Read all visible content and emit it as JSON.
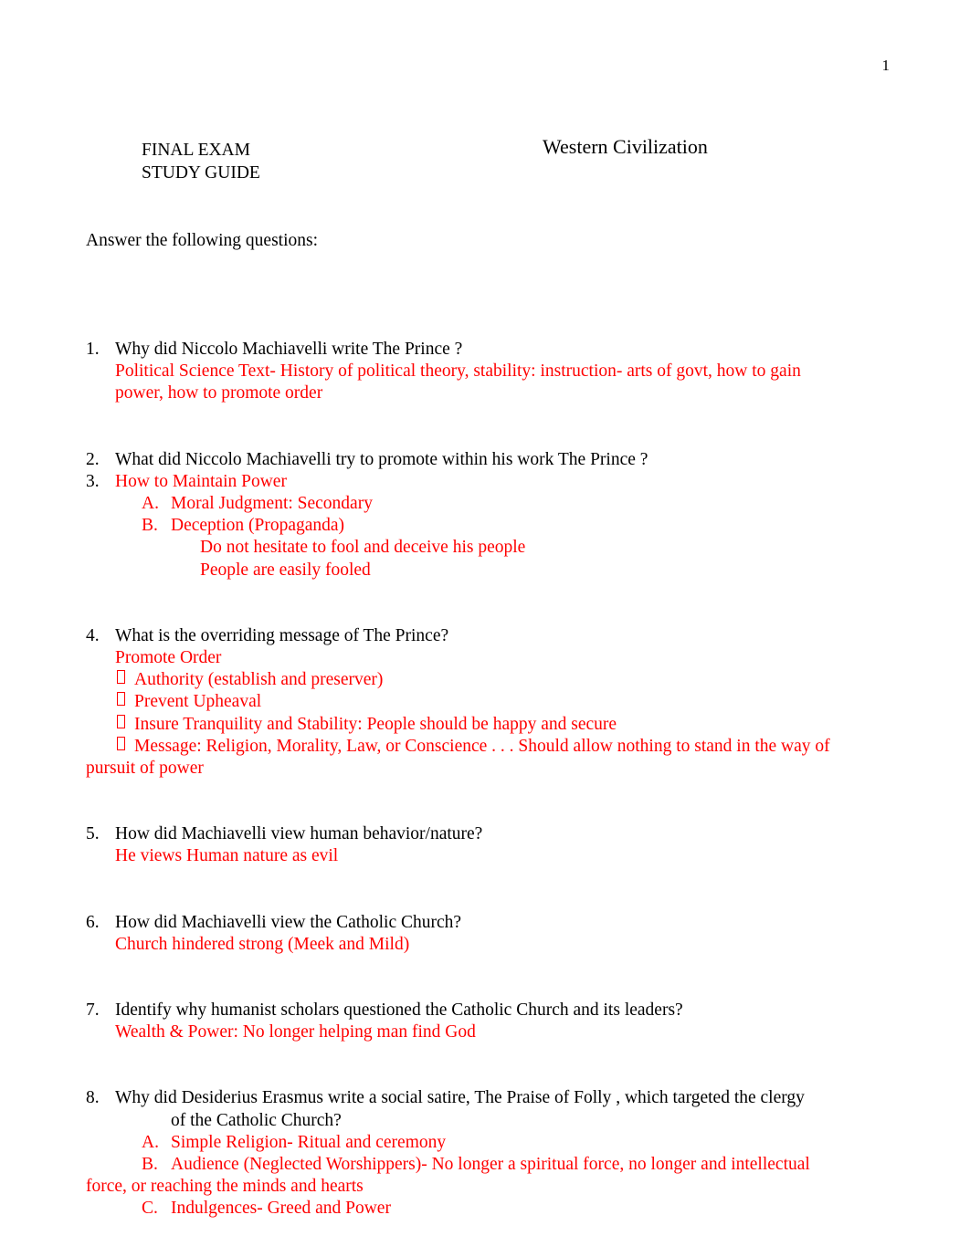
{
  "document": {
    "page_number": "1",
    "header": {
      "left_line1": "FINAL EXAM",
      "left_line2": "STUDY GUIDE",
      "title": "Western Civilization"
    },
    "intro": "Answer the following questions:",
    "colors": {
      "answer_red": "#ff0000",
      "question_black": "#000000",
      "page_background": "#ffffff"
    },
    "bullet_glyph": "tofu-box"
  },
  "items": [
    {
      "number": "1.",
      "question": "Why did Niccolo Machiavelli write The Prince ?",
      "answer_line1": "Political Science Text- History of political theory, stability: instruction- arts of govt, how to gain",
      "answer_line2": "power, how to promote order"
    },
    {
      "number": "2.",
      "question": "What did Niccolo Machiavelli try to promote within his work The Prince ?"
    },
    {
      "number": "3.",
      "answer_heading": "How to Maintain Power",
      "sub_a_label": "A.",
      "sub_a_text": "Moral Judgment: Secondary",
      "sub_b_label": "B.",
      "sub_b_text": "Deception  (Propaganda)",
      "deep_line1": "Do not hesitate to fool and deceive his people",
      "deep_line2": "People are easily fooled"
    },
    {
      "number": "4.",
      "question": "What is the overriding message of The Prince?",
      "answer_heading": "Promote Order",
      "bullets": [
        "Authority (establish and preserver)",
        "Prevent Upheaval",
        "Insure Tranquility and Stability: People should be happy and secure"
      ],
      "bullet_last_line1": "Message:  Religion, Morality, Law, or Conscience . . . Should allow nothing to stand in the way of",
      "bullet_last_line2": "pursuit of power"
    },
    {
      "number": "5.",
      "question": "How did Machiavelli view human behavior/nature?",
      "answer": "He views Human nature as evil"
    },
    {
      "number": "6.",
      "question": "How did Machiavelli view the Catholic Church?",
      "answer": "Church hindered strong (Meek and Mild)"
    },
    {
      "number": "7.",
      "question": "Identify why humanist scholars questioned the Catholic Church and its leaders?",
      "answer": "Wealth & Power: No longer helping man find God"
    },
    {
      "number": "8.",
      "question_line1": "Why did Desiderius Erasmus write a social satire, The Praise of Folly , which targeted the clergy",
      "question_line2": "of the Catholic Church?",
      "sub_a_label": "A.",
      "sub_a_text": "Simple Religion- Ritual and ceremony",
      "sub_b_label": "B.",
      "sub_b_line1": "Audience (Neglected Worshippers)- No longer a spiritual force, no longer and intellectual",
      "sub_b_line2": "force, or reaching the minds and hearts",
      "sub_c_label": "C.",
      "sub_c_text": "Indulgences- Greed and Power"
    }
  ]
}
